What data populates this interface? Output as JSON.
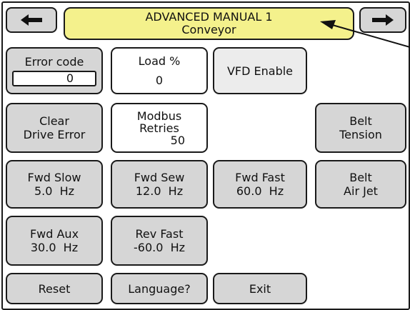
{
  "header": {
    "title": "ADVANCED MANUAL 1",
    "subtitle": "Conveyor",
    "prev_icon": "left-arrow-icon",
    "next_icon": "right-arrow-icon"
  },
  "buttons": {
    "error_code": {
      "label": "Error code",
      "value": "0"
    },
    "load": {
      "label": "Load %",
      "value": "0"
    },
    "vfd_enable": {
      "label": "VFD Enable"
    },
    "clear_drive_error": {
      "line1": "Clear",
      "line2": "Drive Error"
    },
    "modbus_retries": {
      "line1": "Modbus",
      "line2": "Retries",
      "value": "50"
    },
    "belt_tension": {
      "line1": "Belt",
      "line2": "Tension"
    },
    "fwd_slow": {
      "line1": "Fwd Slow",
      "line2": "5.0  Hz"
    },
    "fwd_sew": {
      "line1": "Fwd Sew",
      "line2": "12.0  Hz"
    },
    "fwd_fast": {
      "line1": "Fwd Fast",
      "line2": "60.0  Hz"
    },
    "belt_air_jet": {
      "line1": "Belt",
      "line2": "Air Jet"
    },
    "fwd_aux": {
      "line1": "Fwd Aux",
      "line2": "30.0  Hz"
    },
    "rev_fast": {
      "line1": "Rev Fast",
      "line2": "-60.0  Hz"
    },
    "reset": {
      "label": "Reset"
    },
    "language": {
      "label": "Language?"
    },
    "exit": {
      "label": "Exit"
    }
  },
  "colors": {
    "button_bg": "#d6d6d6",
    "title_bg": "#f4f18c",
    "border": "#1a1a1a"
  }
}
